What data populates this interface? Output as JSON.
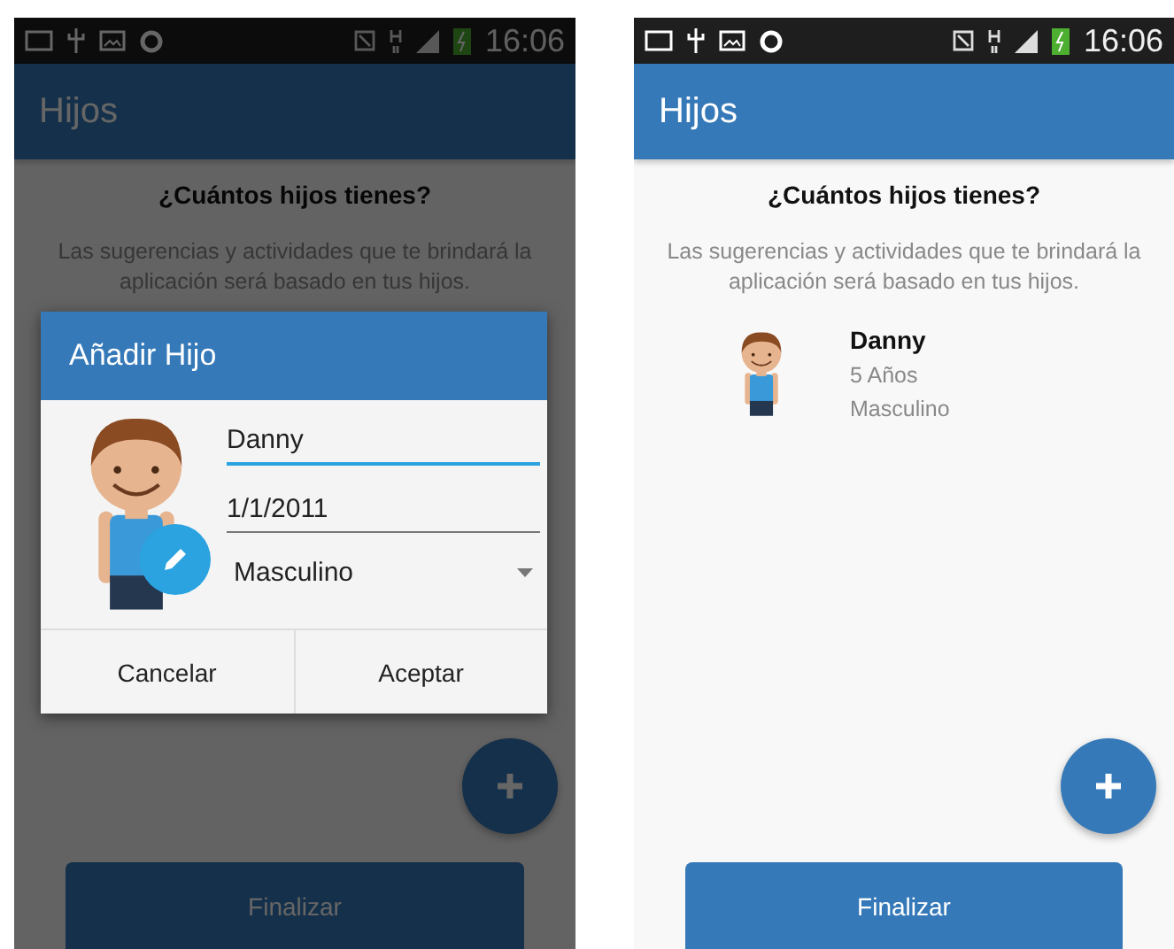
{
  "screens": [
    {
      "dimmed": true,
      "status_bar": {
        "time": "16:06"
      },
      "app_bar": {
        "title": "Hijos"
      },
      "heading": "¿Cuántos hijos tienes?",
      "description": "Las sugerencias y actividades que te brindará la aplicación será basado en tus hijos.",
      "finish_button": {
        "label": "Finalizar"
      },
      "dialog": {
        "title": "Añadir Hijo",
        "name_field": {
          "value": "Danny",
          "focused": true
        },
        "date_field": {
          "value": "1/1/2011",
          "focused": false
        },
        "gender_select": {
          "value": "Masculino"
        },
        "buttons": [
          "Cancelar",
          "Aceptar"
        ]
      }
    },
    {
      "dimmed": false,
      "status_bar": {
        "time": "16:06"
      },
      "app_bar": {
        "title": "Hijos"
      },
      "heading": "¿Cuántos hijos tienes?",
      "description": "Las sugerencias y actividades que te brindará la aplicación será basado en tus hijos.",
      "children": [
        {
          "name": "Danny",
          "age": "5 Años",
          "gender": "Masculino"
        }
      ],
      "finish_button": {
        "label": "Finalizar"
      }
    }
  ]
}
